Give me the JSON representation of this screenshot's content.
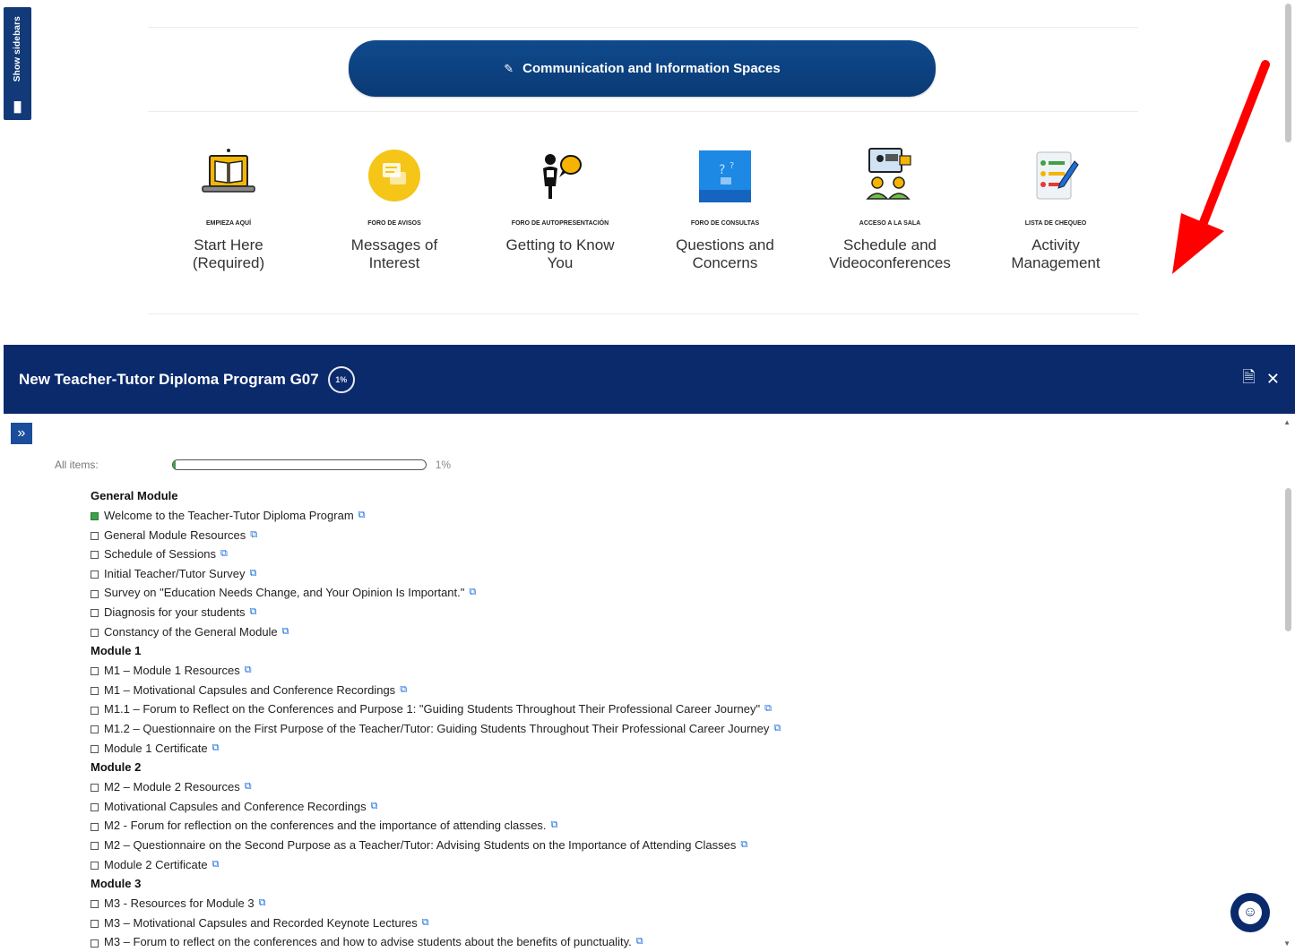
{
  "sidebar_toggle": {
    "label": "Show sidebars",
    "icon": "bars-chart-icon"
  },
  "banner": {
    "icon": "pencil-icon",
    "title": "Communication and Information Spaces"
  },
  "tiles": [
    {
      "caption": "EMPIEZA AQUÍ",
      "label_line1": "Start Here",
      "label_line2": "(Required)",
      "icon": "laptop-book-icon"
    },
    {
      "caption": "FORO DE AVISOS",
      "label_line1": "Messages of",
      "label_line2": "Interest",
      "icon": "messages-icon"
    },
    {
      "caption": "FORO DE AUTOPRESENTACIÓN",
      "label_line1": "Getting to Know",
      "label_line2": "You",
      "icon": "person-speech-icon"
    },
    {
      "caption": "FORO DE CONSULTAS",
      "label_line1": "Questions and",
      "label_line2": "Concerns",
      "icon": "questions-icon"
    },
    {
      "caption": "ACCESO A LA SALA",
      "label_line1": "Schedule and",
      "label_line2": "Videoconferences",
      "icon": "videoconference-icon"
    },
    {
      "caption": "LISTA DE CHEQUEO",
      "label_line1": "Activity",
      "label_line2": "Management",
      "icon": "checklist-icon"
    }
  ],
  "panel": {
    "title": "New Teacher-Tutor Diploma Program G07",
    "progress_badge": "1%",
    "header_icons": [
      "save-icon",
      "close-icon"
    ],
    "all_items_label": "All items:",
    "progress_value": 1,
    "progress_text": "1%"
  },
  "modules": [
    {
      "title": "General Module",
      "items": [
        {
          "text": "Welcome to the Teacher-Tutor Diploma Program",
          "checked": true
        },
        {
          "text": "General Module Resources",
          "checked": false
        },
        {
          "text": "Schedule of Sessions",
          "checked": false
        },
        {
          "text": "Initial Teacher/Tutor Survey",
          "checked": false
        },
        {
          "text": "Survey on \"Education Needs Change, and Your Opinion Is Important.\"",
          "checked": false
        },
        {
          "text": "Diagnosis for your students",
          "checked": false
        },
        {
          "text": "Constancy of the General Module",
          "checked": false
        }
      ]
    },
    {
      "title": "Module 1",
      "items": [
        {
          "text": "M1 – Module 1 Resources",
          "checked": false
        },
        {
          "text": "M1 – Motivational Capsules and Conference Recordings",
          "checked": false
        },
        {
          "text": "M1.1 – Forum to Reflect on the Conferences and Purpose 1: \"Guiding Students Throughout Their Professional Career Journey\"",
          "checked": false
        },
        {
          "text": "M1.2 – Questionnaire on the First Purpose of the Teacher/Tutor: Guiding Students Throughout Their Professional Career Journey",
          "checked": false
        },
        {
          "text": "Module 1 Certificate",
          "checked": false
        }
      ]
    },
    {
      "title": "Module 2",
      "items": [
        {
          "text": "M2 – Module 2 Resources",
          "checked": false
        },
        {
          "text": "Motivational Capsules and Conference Recordings",
          "checked": false
        },
        {
          "text": "M2 - Forum for reflection on the conferences and the importance of attending classes.",
          "checked": false
        },
        {
          "text": "M2 – Questionnaire on the Second Purpose as a Teacher/Tutor: Advising Students on the Importance of Attending Classes",
          "checked": false
        },
        {
          "text": "Module 2 Certificate",
          "checked": false
        }
      ]
    },
    {
      "title": "Module 3",
      "items": [
        {
          "text": "M3 - Resources for Module 3",
          "checked": false
        },
        {
          "text": "M3 – Motivational Capsules and Recorded Keynote Lectures",
          "checked": false
        },
        {
          "text": "M3 – Forum to reflect on the conferences and how to advise students about the benefits of punctuality.",
          "checked": false
        }
      ]
    }
  ],
  "accessibility_button": {
    "icon": "accessibility-icon"
  },
  "colors": {
    "header": "#0a2a6c",
    "banner": "#0f4a8c",
    "progress": "#3aa24a",
    "arrow": "#ff0000",
    "link": "#1a6ed8"
  }
}
